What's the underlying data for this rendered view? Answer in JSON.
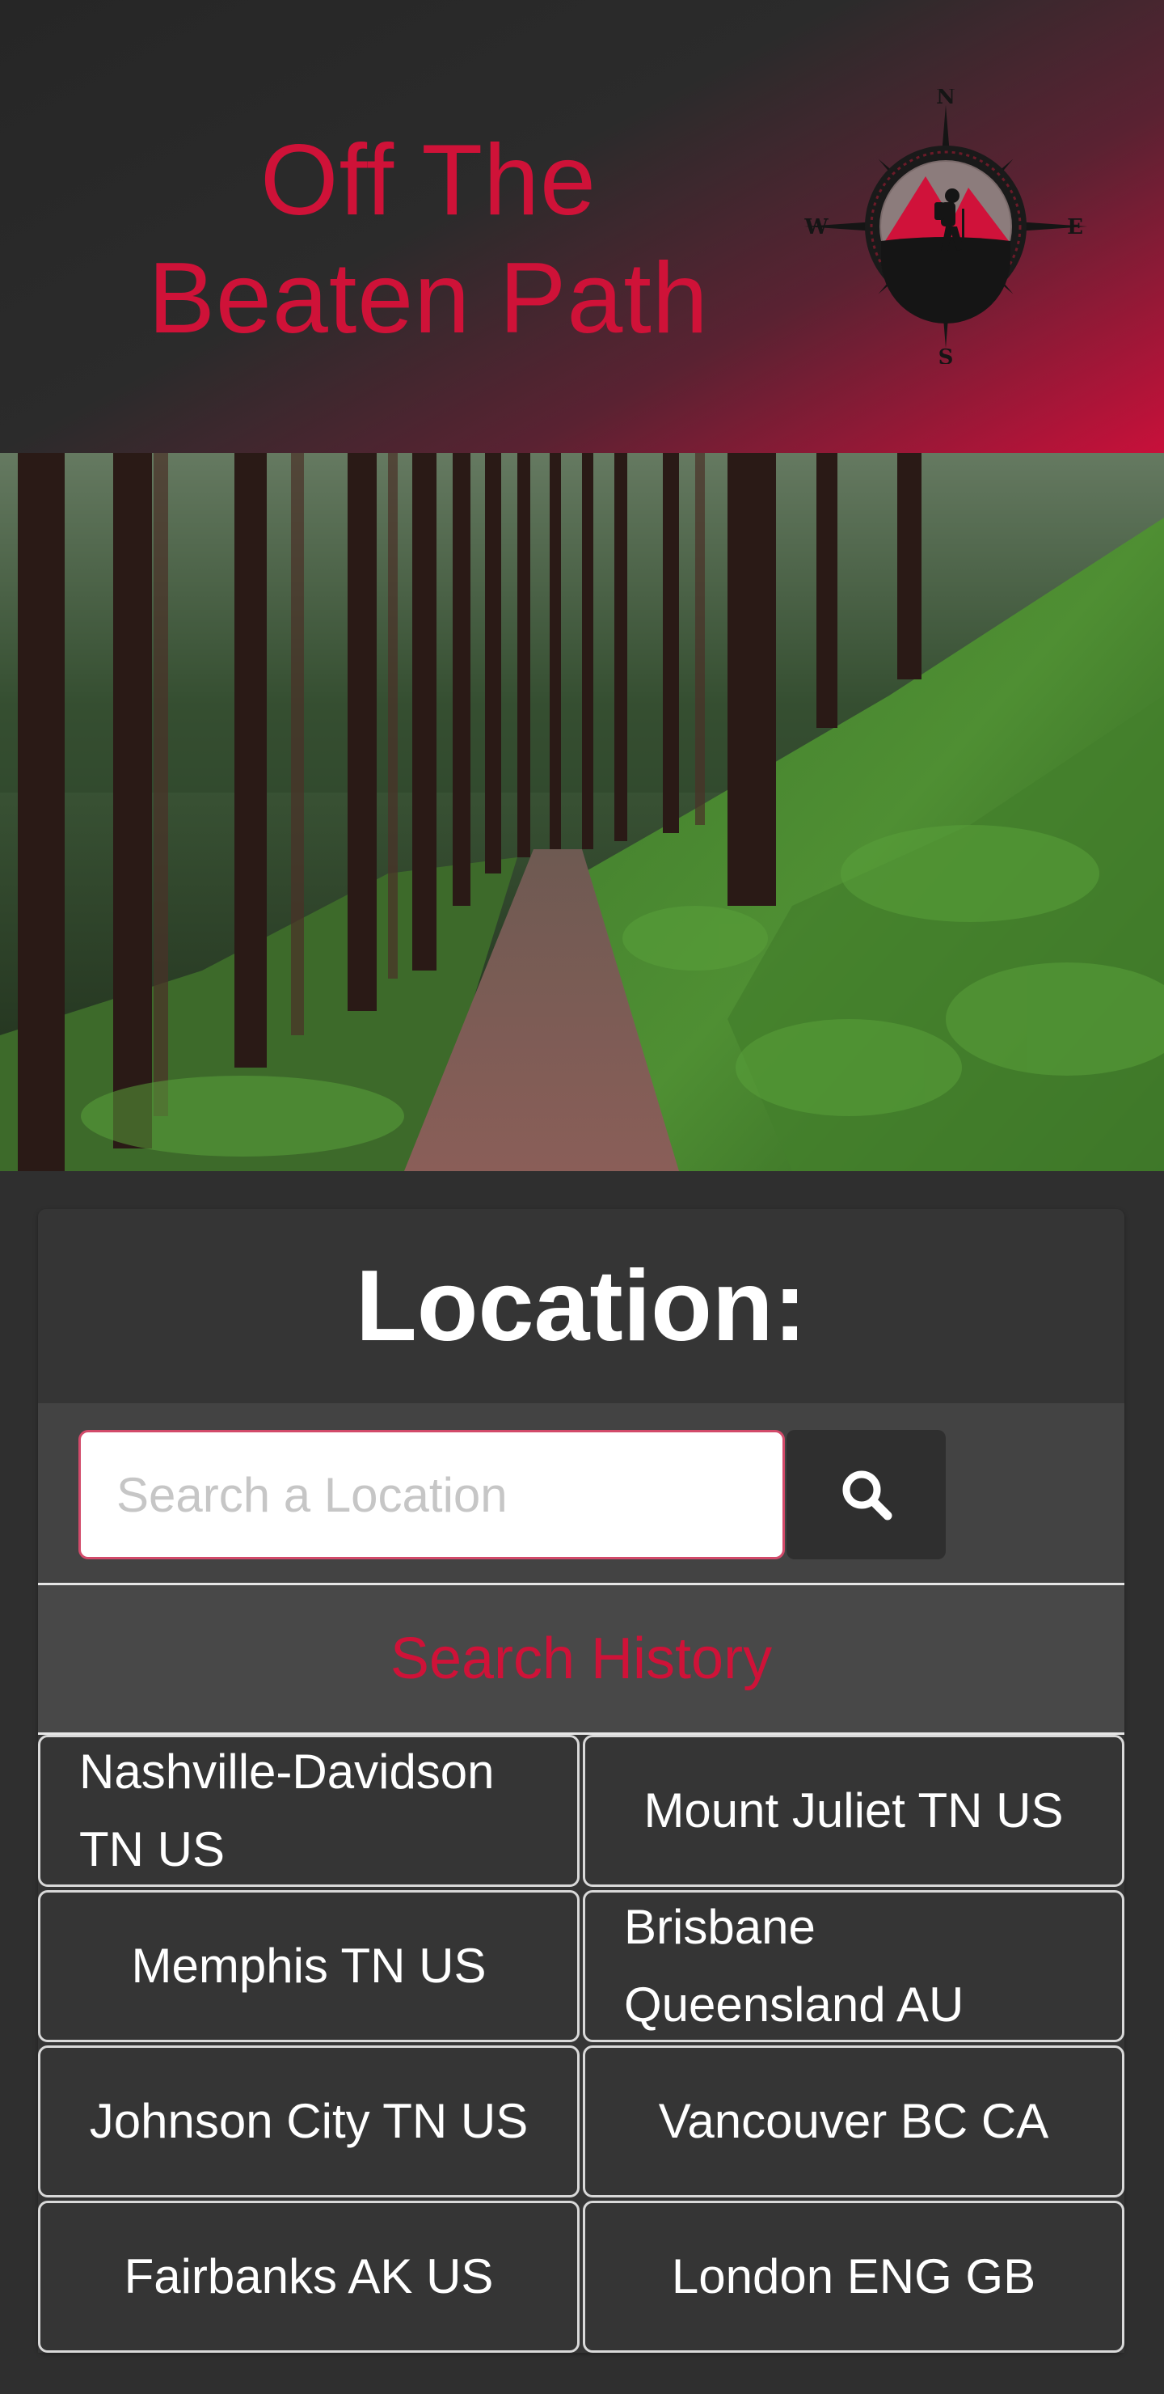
{
  "header": {
    "title_line1": "Off The",
    "title_line2": "Beaten Path",
    "logo": {
      "icon": "compass-hiker-logo",
      "n": "N",
      "e": "E",
      "s": "S",
      "w": "W"
    }
  },
  "hero": {
    "icon": "forest-trail-image"
  },
  "location": {
    "title": "Location:",
    "search_placeholder": "Search a Location",
    "search_value": "",
    "search_icon": "search-icon"
  },
  "history": {
    "title": "Search History",
    "items": [
      {
        "label": "Nashville-Davidson TN US"
      },
      {
        "label": "Mount Juliet TN US"
      },
      {
        "label": "Memphis TN US"
      },
      {
        "label": "Brisbane Queensland AU"
      },
      {
        "label": "Johnson City TN US"
      },
      {
        "label": "Vancouver BC CA"
      },
      {
        "label": "Fairbanks AK US"
      },
      {
        "label": "London ENG GB"
      }
    ]
  },
  "colors": {
    "accent": "#cf1238",
    "background": "#2f2f2f",
    "card": "#353535",
    "history_header": "#484848",
    "search_row": "#434343"
  }
}
